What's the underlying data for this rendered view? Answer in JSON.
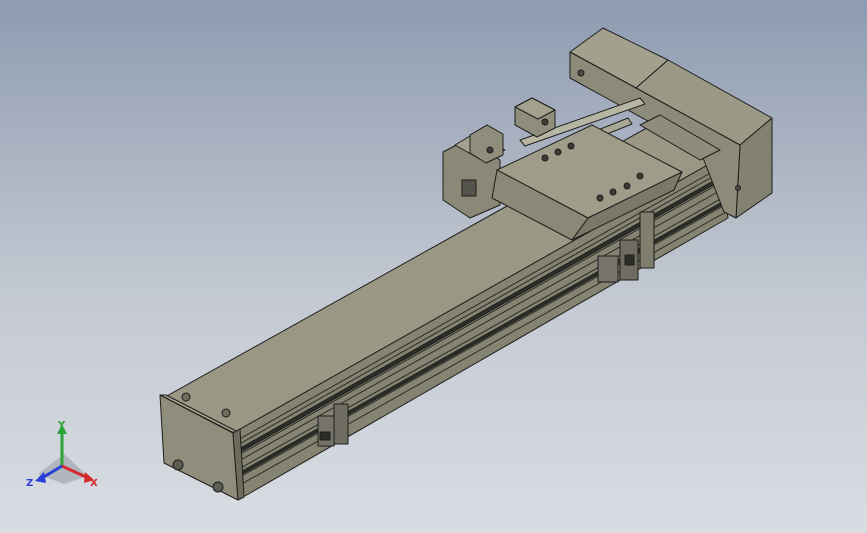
{
  "viewport": {
    "background_top": "#8e9bb0",
    "background_bottom": "#d9dde3"
  },
  "model": {
    "body_color": "#8d8b79",
    "top_color": "#9a9885",
    "dark_color": "#3a3a36",
    "edge_color": "#1e1e1c"
  },
  "triad": {
    "x_label": "X",
    "y_label": "Y",
    "z_label": "Z",
    "x_color": "#d42a2a",
    "y_color": "#2ea33a",
    "z_color": "#2a3fd4"
  }
}
